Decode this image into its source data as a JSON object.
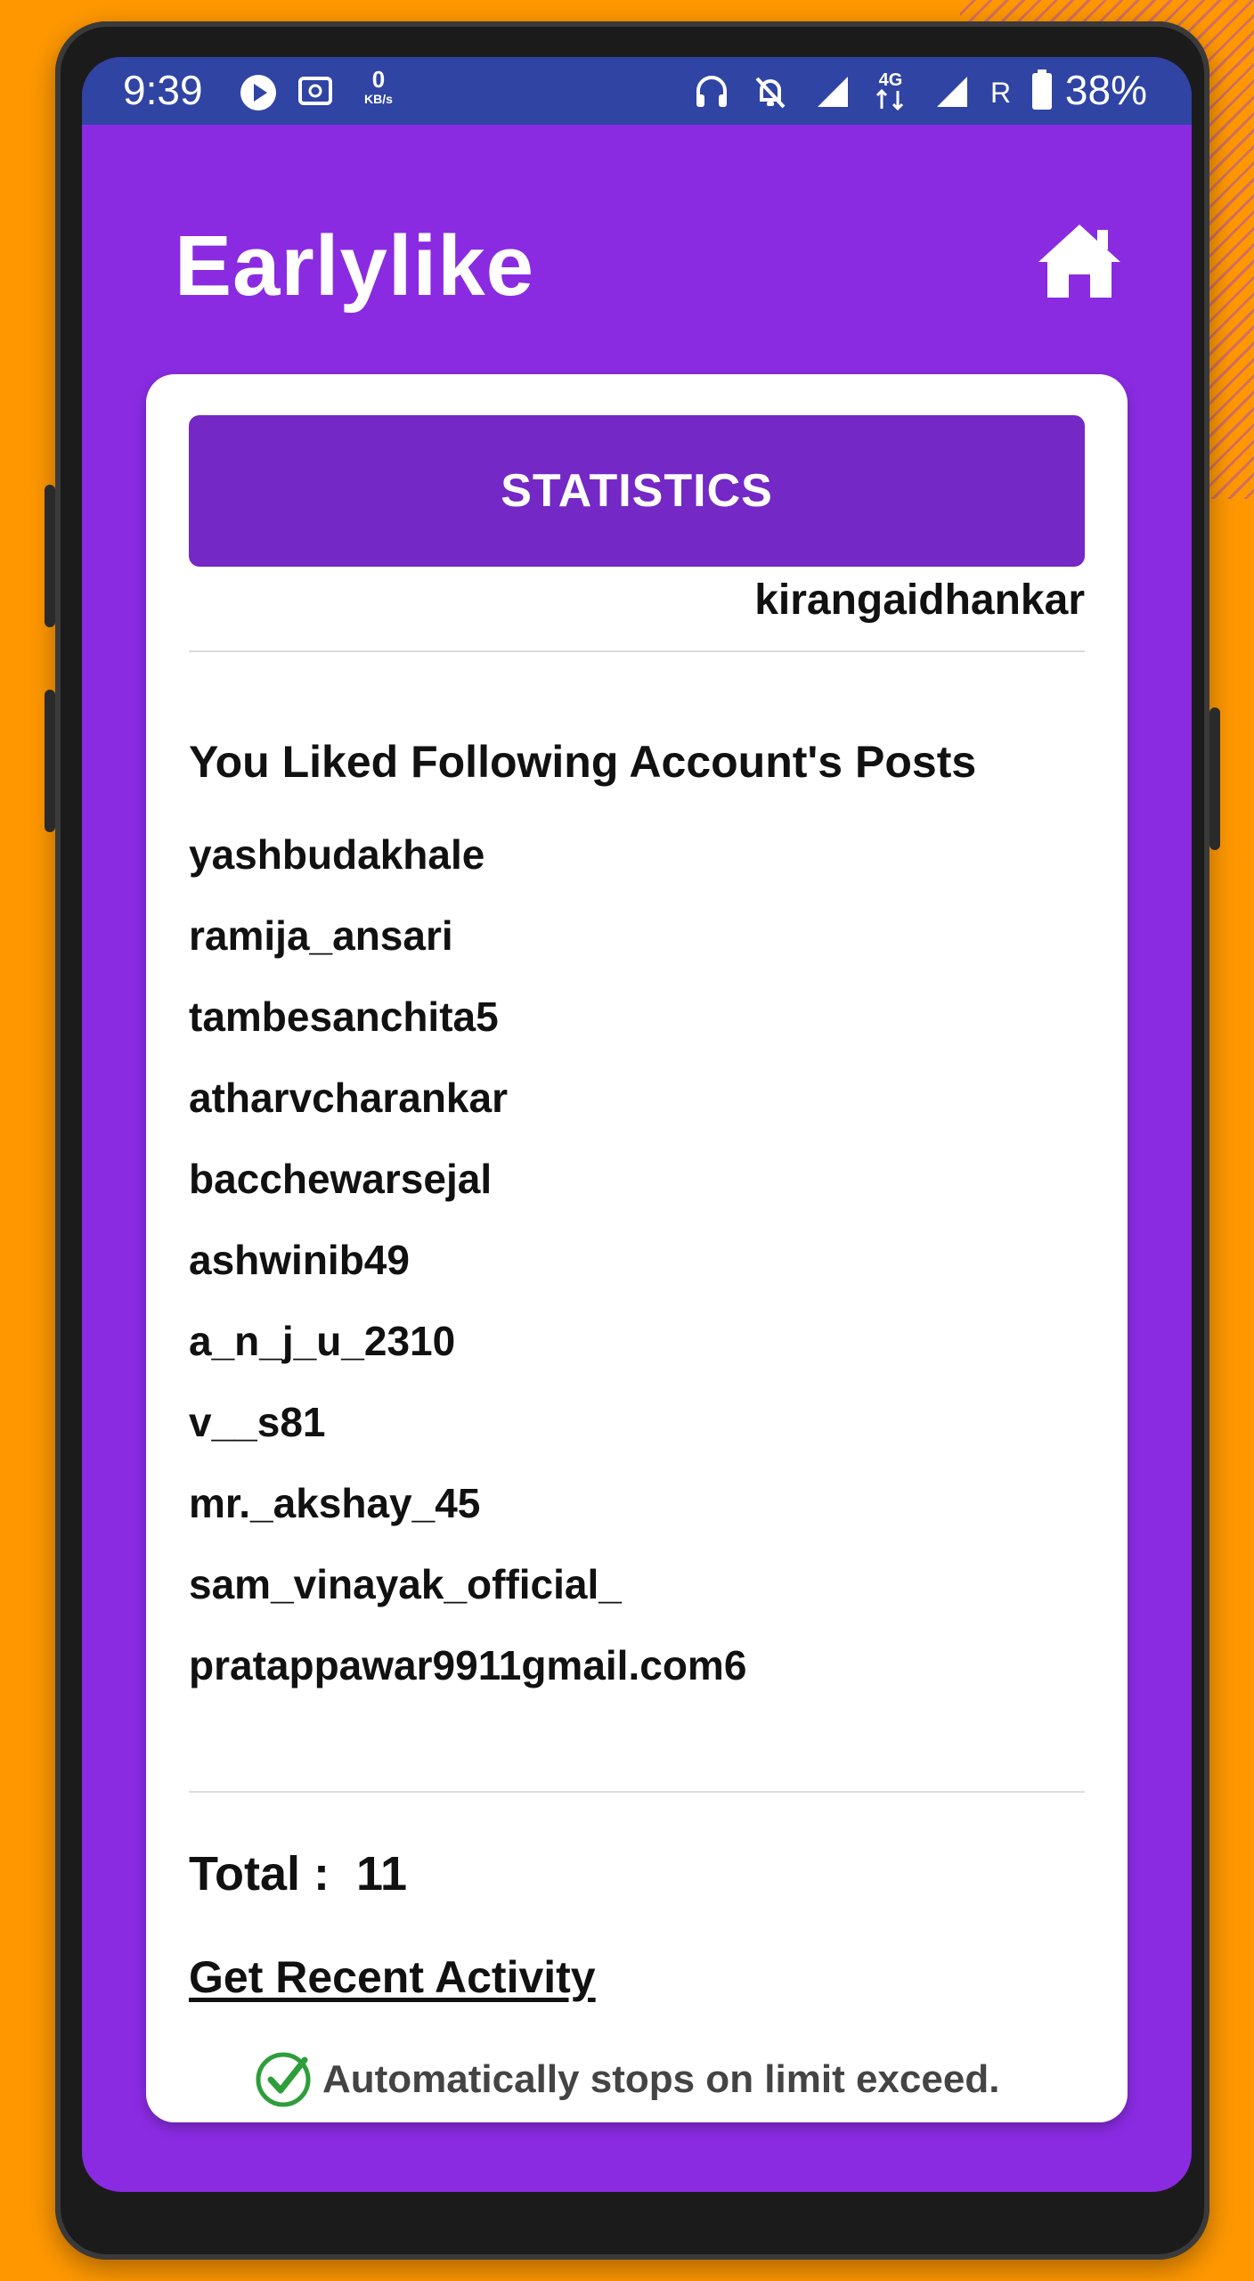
{
  "status_bar": {
    "time": "9:39",
    "net_speed_value": "0",
    "net_speed_unit": "KB/s",
    "network_type": "4G",
    "roaming": "R",
    "battery": "38%",
    "icons": [
      "play-icon",
      "storage-icon",
      "headphones-icon",
      "bell-muted-icon",
      "signal-icon",
      "4g-arrows-icon",
      "signal-icon",
      "battery-icon"
    ]
  },
  "header": {
    "app_title": "Earlylike",
    "home_icon": "home-icon"
  },
  "card": {
    "statistics_button": "STATISTICS",
    "username": "kirangaidhankar",
    "section_heading": "You Liked Following Account's Posts",
    "accounts": [
      "yashbudakhale",
      "ramija_ansari",
      "tambesanchita5",
      "atharvcharankar",
      "bacchewarsejal",
      "ashwinib49",
      "a_n_j_u_2310",
      "v__s81",
      "mr._akshay_45",
      "sam_vinayak_official_",
      "pratappawar9911gmail.com6"
    ],
    "total_label": "Total :  11",
    "recent_activity_link": "Get Recent Activity",
    "auto_note": "Automatically stops on limit exceed."
  },
  "colors": {
    "background": "#FF9800",
    "app_purple": "#8A2BE2",
    "button_purple": "#7428C6",
    "status_bar": "#2F44A3",
    "check_green": "#2E9E3A"
  }
}
